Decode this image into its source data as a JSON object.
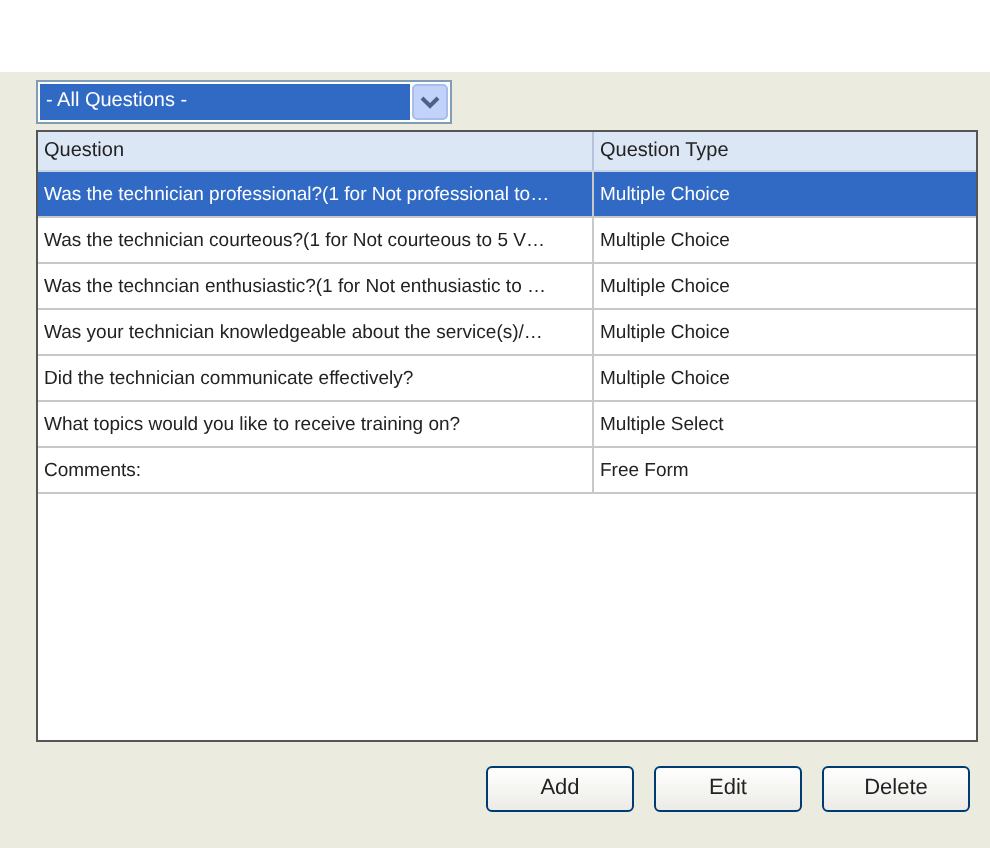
{
  "filter": {
    "value": "- All Questions -"
  },
  "table": {
    "columns": [
      "Question",
      "Question Type"
    ],
    "rows": [
      {
        "cells": [
          "Was the technician professional?(1 for Not professional to…",
          "Multiple Choice"
        ],
        "selected": true
      },
      {
        "cells": [
          "Was the technician courteous?(1 for Not courteous to 5 V…",
          "Multiple Choice"
        ],
        "selected": false
      },
      {
        "cells": [
          "Was the techncian enthusiastic?(1 for Not enthusiastic to …",
          "Multiple Choice"
        ],
        "selected": false
      },
      {
        "cells": [
          "Was your technician knowledgeable about the service(s)/…",
          "Multiple Choice"
        ],
        "selected": false
      },
      {
        "cells": [
          "Did the technician communicate effectively?",
          "Multiple Choice"
        ],
        "selected": false
      },
      {
        "cells": [
          "What topics would you like to receive training on?",
          "Multiple Select"
        ],
        "selected": false
      },
      {
        "cells": [
          "Comments:",
          "Free Form"
        ],
        "selected": false
      }
    ]
  },
  "buttons": [
    "Add",
    "Edit",
    "Delete"
  ]
}
